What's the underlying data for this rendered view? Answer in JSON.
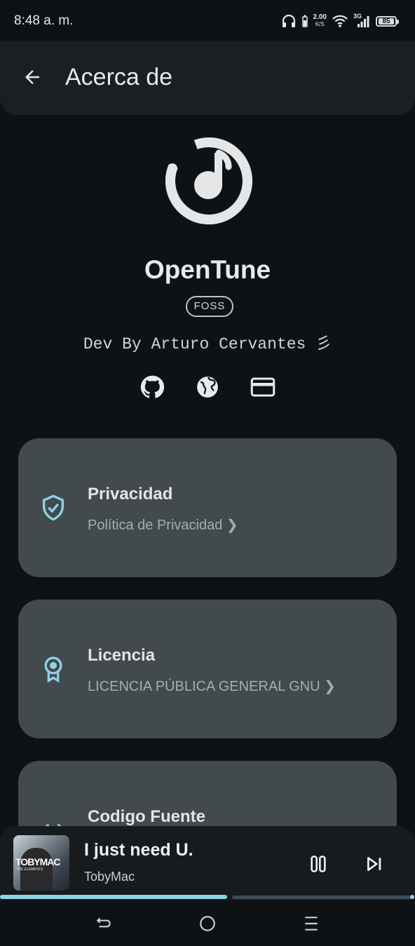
{
  "status_bar": {
    "time": "8:48 a. m.",
    "network_speed_value": "2.00",
    "network_speed_unit": "K/S",
    "network_type": "3G",
    "battery": "85"
  },
  "top_bar": {
    "title": "Acerca de"
  },
  "app": {
    "name": "OpenTune",
    "badge": "FOSS",
    "developer": "Dev By Arturo Cervantes 彡"
  },
  "cards": [
    {
      "title": "Privacidad",
      "subtitle": "Política de Privacidad ❯",
      "icon": "shield-check-icon"
    },
    {
      "title": "Licencia",
      "subtitle": "LICENCIA PÚBLICA GENERAL GNU ❯",
      "icon": "award-icon"
    },
    {
      "title": "Codigo Fuente",
      "subtitle": "",
      "icon": "code-icon"
    }
  ],
  "now_playing": {
    "title": "I just need U.",
    "artist": "TobyMac",
    "album_art_text": "TOBYMAC",
    "album_art_subtext": "THE ELEMENTS",
    "progress": 0.55
  },
  "colors": {
    "accent": "#8fd1e6",
    "background": "#0e1215",
    "card": "#424a4e",
    "topbar": "#1b1f22"
  }
}
